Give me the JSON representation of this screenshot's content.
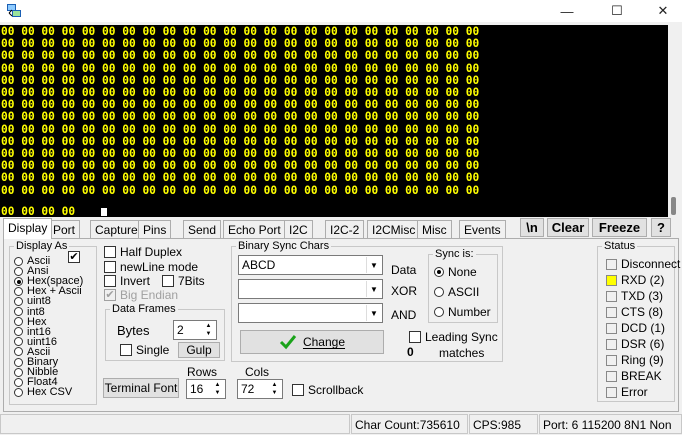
{
  "window": {
    "app_icon": "app-icon",
    "controls": [
      "minimize-icon",
      "maximize-icon",
      "close-icon"
    ]
  },
  "terminal": {
    "line_text": "00 00 00 00 00 00 00 00 00 00 00 00 00 00 00 00 00 00 00 00 00 00 00 00",
    "full_rows": 14,
    "last_line": "00 00 00 00",
    "text_color": "#ffff00",
    "background": "#000000"
  },
  "tabs": [
    "Display",
    "Port",
    "Capture",
    "Pins",
    "Send",
    "Echo Port",
    "I2C",
    "I2C-2",
    "I2CMisc",
    "Misc",
    "Events"
  ],
  "active_tab": "Display",
  "toolbar": {
    "newline_btn": "\\n",
    "clear_btn": "Clear",
    "freeze_btn": "Freeze",
    "help_btn": "?"
  },
  "display_as": {
    "legend": "Display As",
    "options": [
      "Ascii",
      "Ansi",
      "Hex(space)",
      "Hex + Ascii",
      "uint8",
      "int8",
      "Hex",
      "int16",
      "uint16",
      "Ascii",
      "Binary",
      "Nibble",
      "Float4",
      "Hex CSV"
    ],
    "selected": "Hex(space)",
    "check": "✔"
  },
  "options": {
    "half_duplex": "Half Duplex",
    "newline_mode": "newLine mode",
    "invert": "Invert",
    "seven_bits": "7Bits",
    "big_endian": "Big Endian"
  },
  "data_frames": {
    "legend": "Data Frames",
    "bytes_label": "Bytes",
    "bytes_value": "2",
    "single_label": "Single",
    "gulp_btn": "Gulp"
  },
  "terminal_font_btn": "Terminal Font",
  "rows": {
    "label": "Rows",
    "value": "16"
  },
  "cols": {
    "label": "Cols",
    "value": "72"
  },
  "scrollback": "Scrollback",
  "binary_sync": {
    "legend": "Binary Sync Chars",
    "data_value": "ABCD",
    "data_label": "Data",
    "xor_value": "",
    "xor_label": "XOR",
    "and_value": "",
    "and_label": "AND",
    "change_btn": "Change",
    "change_icon": "green-check-icon",
    "count": "0"
  },
  "sync_is": {
    "legend": "Sync is:",
    "options": [
      "None",
      "ASCII",
      "Number"
    ],
    "selected": "None"
  },
  "leading_sync": {
    "line1": "Leading Sync",
    "line2": "matches"
  },
  "status": {
    "legend": "Status",
    "items": [
      {
        "label": "Disconnect",
        "led": false
      },
      {
        "label": "RXD (2)",
        "led": true
      },
      {
        "label": "TXD (3)",
        "led": false
      },
      {
        "label": "CTS (8)",
        "led": false
      },
      {
        "label": "DCD (1)",
        "led": false
      },
      {
        "label": "DSR (6)",
        "led": false
      },
      {
        "label": "Ring (9)",
        "led": false
      },
      {
        "label": "BREAK",
        "led": false
      },
      {
        "label": "Error",
        "led": false
      }
    ],
    "led_on_color": "#ffff00"
  },
  "statusbar": {
    "char_count": "Char Count:735610",
    "cps": "CPS:985",
    "port": "Port: 6 115200 8N1 Non"
  }
}
